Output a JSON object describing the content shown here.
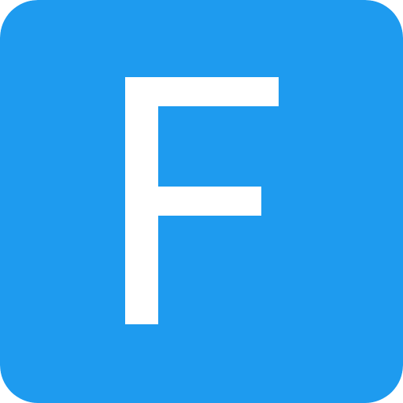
{
  "icon": {
    "name": "letter-f-icon",
    "letter": "F",
    "background_color": "#1E9BEF",
    "letter_color": "#FFFFFF"
  }
}
